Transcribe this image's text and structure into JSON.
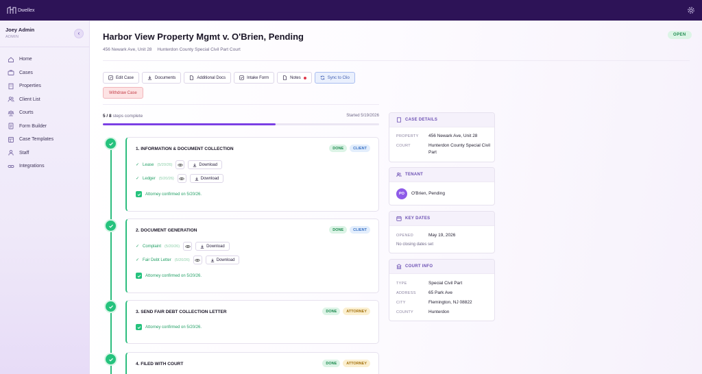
{
  "app": {
    "logo_text": "Dwellex"
  },
  "sidebar": {
    "user_name": "Joey Admin",
    "user_role": "ADMIN",
    "items": [
      {
        "label": "Home",
        "icon": "home-icon"
      },
      {
        "label": "Cases",
        "icon": "briefcase-icon"
      },
      {
        "label": "Properties",
        "icon": "building-icon"
      },
      {
        "label": "Client List",
        "icon": "users-icon"
      },
      {
        "label": "Courts",
        "icon": "scale-icon"
      },
      {
        "label": "Form Builder",
        "icon": "form-icon"
      },
      {
        "label": "Case Templates",
        "icon": "template-icon"
      },
      {
        "label": "Staff",
        "icon": "staff-icon"
      },
      {
        "label": "Integrations",
        "icon": "link-icon"
      }
    ]
  },
  "case": {
    "title": "Harbor View Property Mgmt v. O'Brien, Pending",
    "address": "456 Newark Ave, Unit 28",
    "court": "Hunterdon County Special Civil Part Court",
    "status": "OPEN"
  },
  "toolbar": {
    "edit_case": "Edit Case",
    "documents": "Documents",
    "additional_docs": "Additional Docs",
    "intake_form": "Intake Form",
    "notes": "Notes",
    "sync": "Sync to Clio",
    "withdraw": "Withdraw Case"
  },
  "progress": {
    "count": "5 / 8",
    "label": "steps complete",
    "started": "Started 5/19/2026",
    "fraction": 0.625
  },
  "steps": [
    {
      "title": "1. INFORMATION & DOCUMENT COLLECTION",
      "badges": [
        "DONE",
        "CLIENT"
      ],
      "docs": [
        {
          "name": "Lease",
          "date": "(5/20/26)",
          "action": "Download"
        },
        {
          "name": "Ledger",
          "date": "(5/20/26)",
          "action": "Download"
        }
      ],
      "confirmation": "Attorney confirmed on 5/20/26."
    },
    {
      "title": "2. DOCUMENT GENERATION",
      "badges": [
        "DONE",
        "CLIENT"
      ],
      "docs": [
        {
          "name": "Complaint",
          "date": "(5/20/26)",
          "action": "Download"
        },
        {
          "name": "Fair Debt Letter",
          "date": "(5/20/26)",
          "action": "Download"
        }
      ],
      "confirmation": "Attorney confirmed on 5/20/26."
    },
    {
      "title": "3. SEND FAIR DEBT COLLECTION LETTER",
      "badges": [
        "DONE",
        "ATTORNEY"
      ],
      "confirmation": "Attorney confirmed on 5/20/26."
    },
    {
      "title": "4. FILED WITH COURT",
      "badges": [
        "DONE",
        "ATTORNEY"
      ]
    }
  ],
  "details": {
    "case_details": {
      "header": "CASE DETAILS",
      "property_label": "PROPERTY",
      "property": "456 Newark Ave, Unit 28",
      "court_label": "COURT",
      "court": "Hunterdon County Special Civil Part"
    },
    "tenant": {
      "header": "TENANT",
      "initials": "PO",
      "name": "O'Brien, Pending"
    },
    "key_dates": {
      "header": "KEY DATES",
      "opened_label": "OPENED",
      "opened": "May 19, 2026",
      "closing": "No closing dates set"
    },
    "court_info": {
      "header": "COURT INFO",
      "type_label": "TYPE",
      "type": "Special Civil Part",
      "address_label": "ADDRESS",
      "address": "65 Park Ave",
      "city_label": "CITY",
      "city": "Flemington, NJ 08822",
      "county_label": "COUNTY",
      "county": "Hunterdon"
    }
  },
  "colors": {
    "topbar": "#2d1357",
    "accent": "#7b3fe4",
    "success": "#25c27d",
    "danger": "#c33d47"
  }
}
